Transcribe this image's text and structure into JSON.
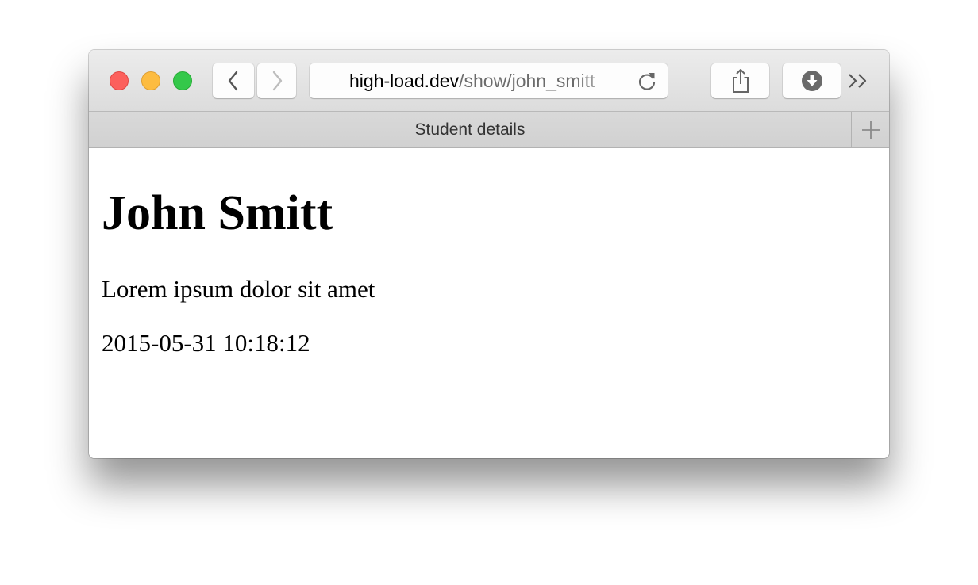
{
  "browser": {
    "url_host": "high-load.dev",
    "url_path": "/show/john_smitt",
    "tab_title": "Student details"
  },
  "page": {
    "heading": "John Smitt",
    "description": "Lorem ipsum dolor sit amet",
    "timestamp": "2015-05-31 10:18:12"
  },
  "icons": {
    "close": "close-traffic-light",
    "minimize": "minimize-traffic-light",
    "maximize": "maximize-traffic-light",
    "back": "chevron-left-icon",
    "forward": "chevron-right-icon",
    "reload": "reload-icon",
    "share": "share-icon",
    "download": "download-icon",
    "more": "double-chevron-right-icon",
    "new_tab": "plus-icon"
  },
  "colors": {
    "close": "#fc605c",
    "minimize": "#fdbc40",
    "maximize": "#34c84a"
  }
}
